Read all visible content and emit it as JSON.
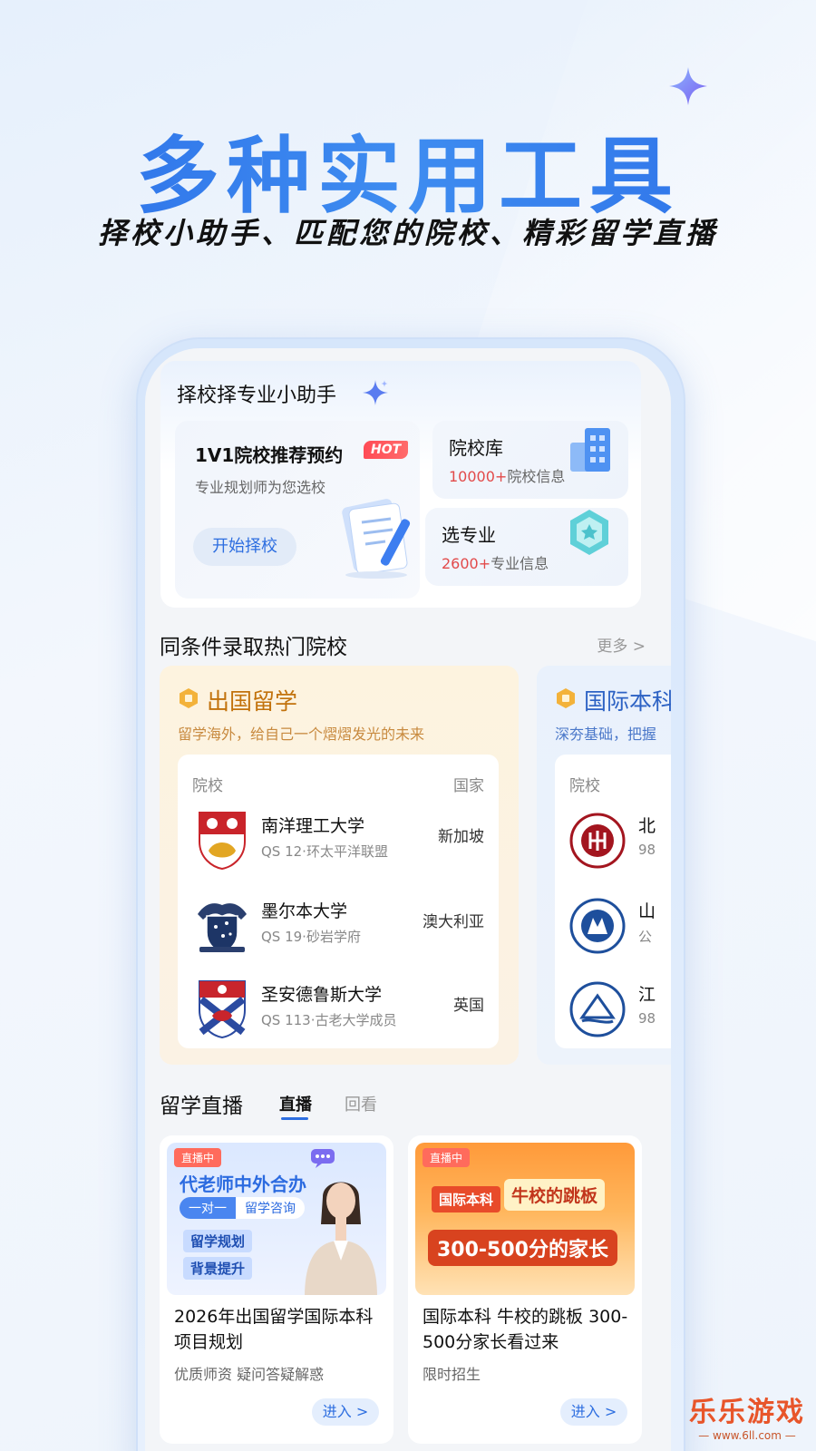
{
  "hero": {
    "title": "多种实用工具",
    "subtitle": "择校小助手、匹配您的院校、精彩留学直播"
  },
  "helper": {
    "title": "择校择专业小助手",
    "booking": {
      "title": "1V1院校推荐预约",
      "badge": "HOT",
      "desc": "专业规划师为您选校",
      "button": "开始择校"
    },
    "school_db": {
      "title": "院校库",
      "count": "10000+",
      "suffix": "院校信息"
    },
    "major": {
      "title": "选专业",
      "count": "2600+",
      "suffix": "专业信息"
    }
  },
  "hot_schools": {
    "title": "同条件录取热门院校",
    "more": "更多 >",
    "categories": [
      {
        "title": "出国留学",
        "desc": "留学海外，给自己一个熠熠发光的未来",
        "col_school": "院校",
        "col_country": "国家",
        "rows": [
          {
            "name": "南洋理工大学",
            "meta": "QS 12·环太平洋联盟",
            "country": "新加坡"
          },
          {
            "name": "墨尔本大学",
            "meta": "QS 19·砂岩学府",
            "country": "澳大利亚"
          },
          {
            "name": "圣安德鲁斯大学",
            "meta": "QS 113·古老大学成员",
            "country": "英国"
          }
        ]
      },
      {
        "title": "国际本科",
        "desc": "深夯基础，把握",
        "col_school": "院校",
        "rows": [
          {
            "name": "北",
            "meta": "98"
          },
          {
            "name": "山",
            "meta": "公"
          },
          {
            "name": "江",
            "meta": "98"
          }
        ]
      }
    ]
  },
  "live": {
    "title": "留学直播",
    "tab_live": "直播",
    "tab_replay": "回看",
    "cards": [
      {
        "tag": "直播中",
        "poster_head": "代老师中外合办",
        "pill_a": "一对一",
        "pill_b": "留学咨询",
        "chip1": "留学规划",
        "chip2": "背景提升",
        "title": "2026年出国留学国际本科项目规划",
        "desc": "优质师资 疑问答疑解惑",
        "button": "进入 >"
      },
      {
        "tag": "直播中",
        "poster_left": "国际本科",
        "poster_right": "牛校的跳板",
        "poster_big": "300-500分的家长",
        "title": "国际本科 牛校的跳板 300-500分家长看过来",
        "desc": "限时招生",
        "button": "进入 >"
      }
    ]
  },
  "watermark": {
    "main": "乐乐游戏",
    "sub": "— www.6ll.com —"
  }
}
